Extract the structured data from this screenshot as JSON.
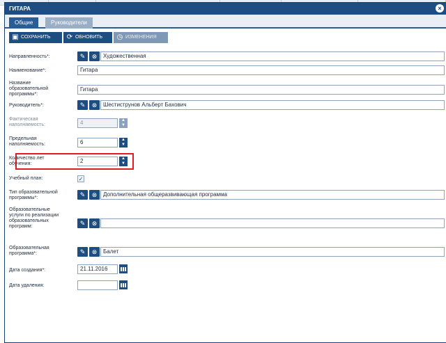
{
  "window": {
    "title": "ГИТАРА"
  },
  "tabs": [
    {
      "label": "Общие"
    },
    {
      "label": "Руководители"
    }
  ],
  "toolbar": {
    "save": "СОХРАНИТЬ",
    "refresh": "ОБНОВИТЬ",
    "changes": "ИЗМЕНЕНИЯ"
  },
  "fields": {
    "napravlennost": {
      "label": "Направленность*:",
      "value": "Художественная"
    },
    "naimenovanie": {
      "label": "Наименование*:",
      "value": "Гитара"
    },
    "nazvanie": {
      "label": "Название образовательной программы*:",
      "value": "Гитара"
    },
    "rukovoditel": {
      "label": "Руководитель*:",
      "value": "Шестиструнов Альберт Бахович"
    },
    "fakticheskaya": {
      "label": "Фактическая наполняемость:",
      "value": "4"
    },
    "predelnaya": {
      "label": "Предельная наполняемость:",
      "value": "6"
    },
    "kolichestvo": {
      "label": "Количество лет обучения:",
      "value": "2"
    },
    "uchebny_plan": {
      "label": "Учебный план:",
      "checked": true
    },
    "tip": {
      "label": "Тип образовательной программы*:",
      "value": "Дополнительная общеразвивающая программа"
    },
    "uslugi": {
      "label": "Образовательные услуги по реализации образовательных программ:",
      "value": ""
    },
    "obr_programma": {
      "label": "Образовательная программа*:",
      "value": "Балет"
    },
    "data_sozdaniya": {
      "label": "Дата создания*:",
      "value": "21.11.2016"
    },
    "data_udaleniya": {
      "label": "Дата удаления:",
      "value": ""
    }
  },
  "colors": {
    "primary": "#1e4d82",
    "highlight": "#e51a22"
  }
}
